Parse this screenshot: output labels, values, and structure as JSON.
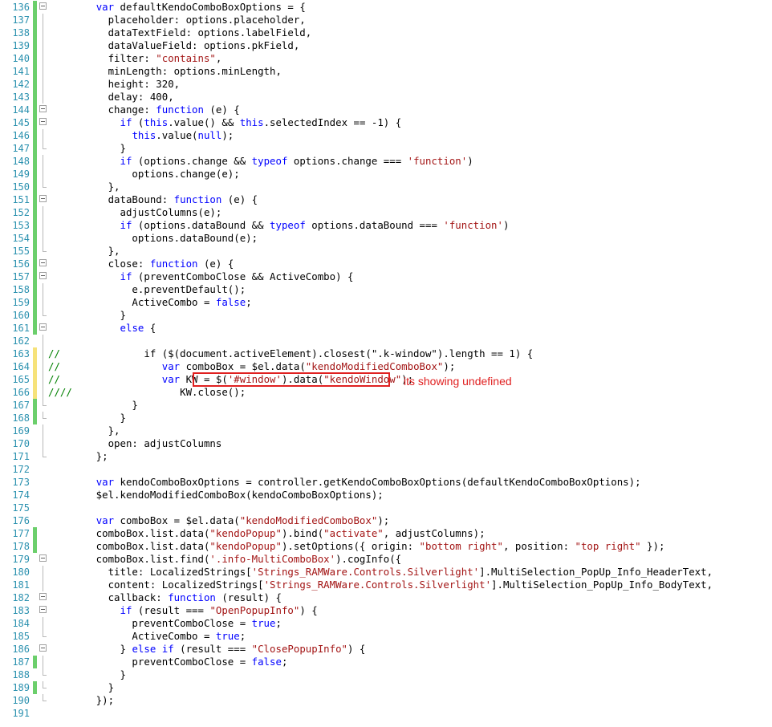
{
  "editor": {
    "lines": [
      {
        "n": "136",
        "bar": "g",
        "fold": true,
        "code": [
          [
            "        ",
            ""
          ],
          [
            "var",
            "k"
          ],
          [
            " defaultKendoComboBoxOptions = {",
            ""
          ]
        ]
      },
      {
        "n": "137",
        "bar": "g",
        "fold": false,
        "code": [
          [
            "          placeholder: options.placeholder,",
            ""
          ]
        ]
      },
      {
        "n": "138",
        "bar": "g",
        "fold": false,
        "code": [
          [
            "          dataTextField: options.labelField,",
            ""
          ]
        ]
      },
      {
        "n": "139",
        "bar": "g",
        "fold": false,
        "code": [
          [
            "          dataValueField: options.pkField,",
            ""
          ]
        ]
      },
      {
        "n": "140",
        "bar": "g",
        "fold": false,
        "code": [
          [
            "          filter: ",
            ""
          ],
          [
            "\"contains\"",
            "s"
          ],
          [
            ",",
            ""
          ]
        ]
      },
      {
        "n": "141",
        "bar": "g",
        "fold": false,
        "code": [
          [
            "          minLength: options.minLength,",
            ""
          ]
        ]
      },
      {
        "n": "142",
        "bar": "g",
        "fold": false,
        "code": [
          [
            "          height: 320,",
            ""
          ]
        ]
      },
      {
        "n": "143",
        "bar": "g",
        "fold": false,
        "code": [
          [
            "          delay: 400,",
            ""
          ]
        ]
      },
      {
        "n": "144",
        "bar": "g",
        "fold": true,
        "code": [
          [
            "          change: ",
            ""
          ],
          [
            "function",
            "k"
          ],
          [
            " (e) {",
            ""
          ]
        ]
      },
      {
        "n": "145",
        "bar": "g",
        "fold": true,
        "code": [
          [
            "            ",
            ""
          ],
          [
            "if",
            "k"
          ],
          [
            " (",
            ""
          ],
          [
            "this",
            "k"
          ],
          [
            ".value() && ",
            ""
          ],
          [
            "this",
            "k"
          ],
          [
            ".selectedIndex == -1) {",
            ""
          ]
        ]
      },
      {
        "n": "146",
        "bar": "g",
        "fold": false,
        "code": [
          [
            "              ",
            ""
          ],
          [
            "this",
            "k"
          ],
          [
            ".value(",
            ""
          ],
          [
            "null",
            "k"
          ],
          [
            ");",
            ""
          ]
        ]
      },
      {
        "n": "147",
        "bar": "g",
        "fold": false,
        "code": [
          [
            "            }",
            ""
          ]
        ]
      },
      {
        "n": "148",
        "bar": "g",
        "fold": false,
        "code": [
          [
            "            ",
            ""
          ],
          [
            "if",
            "k"
          ],
          [
            " (options.change && ",
            ""
          ],
          [
            "typeof",
            "k"
          ],
          [
            " options.change === ",
            ""
          ],
          [
            "'function'",
            "s"
          ],
          [
            ")",
            ""
          ]
        ]
      },
      {
        "n": "149",
        "bar": "g",
        "fold": false,
        "code": [
          [
            "              options.change(e);",
            ""
          ]
        ]
      },
      {
        "n": "150",
        "bar": "g",
        "fold": false,
        "code": [
          [
            "          },",
            ""
          ]
        ]
      },
      {
        "n": "151",
        "bar": "g",
        "fold": true,
        "code": [
          [
            "          dataBound: ",
            ""
          ],
          [
            "function",
            "k"
          ],
          [
            " (e) {",
            ""
          ]
        ]
      },
      {
        "n": "152",
        "bar": "g",
        "fold": false,
        "code": [
          [
            "            adjustColumns(e);",
            ""
          ]
        ]
      },
      {
        "n": "153",
        "bar": "g",
        "fold": false,
        "code": [
          [
            "            ",
            ""
          ],
          [
            "if",
            "k"
          ],
          [
            " (options.dataBound && ",
            ""
          ],
          [
            "typeof",
            "k"
          ],
          [
            " options.dataBound === ",
            ""
          ],
          [
            "'function'",
            "s"
          ],
          [
            ")",
            ""
          ]
        ]
      },
      {
        "n": "154",
        "bar": "g",
        "fold": false,
        "code": [
          [
            "              options.dataBound(e);",
            ""
          ]
        ]
      },
      {
        "n": "155",
        "bar": "g",
        "fold": false,
        "code": [
          [
            "          },",
            ""
          ]
        ]
      },
      {
        "n": "156",
        "bar": "g",
        "fold": true,
        "code": [
          [
            "          close: ",
            ""
          ],
          [
            "function",
            "k"
          ],
          [
            " (e) {",
            ""
          ]
        ]
      },
      {
        "n": "157",
        "bar": "g",
        "fold": true,
        "code": [
          [
            "            ",
            ""
          ],
          [
            "if",
            "k"
          ],
          [
            " (preventComboClose && ActiveCombo) {",
            ""
          ]
        ]
      },
      {
        "n": "158",
        "bar": "g",
        "fold": false,
        "code": [
          [
            "              e.preventDefault();",
            ""
          ]
        ]
      },
      {
        "n": "159",
        "bar": "g",
        "fold": false,
        "code": [
          [
            "              ActiveCombo = ",
            ""
          ],
          [
            "false",
            "k"
          ],
          [
            ";",
            ""
          ]
        ]
      },
      {
        "n": "160",
        "bar": "g",
        "fold": false,
        "code": [
          [
            "            }",
            ""
          ]
        ]
      },
      {
        "n": "161",
        "bar": "g",
        "fold": true,
        "code": [
          [
            "            ",
            ""
          ],
          [
            "else",
            "k"
          ],
          [
            " {",
            ""
          ]
        ]
      },
      {
        "n": "162",
        "bar": "",
        "fold": false,
        "code": [
          [
            "",
            ""
          ]
        ]
      },
      {
        "n": "163",
        "bar": "y",
        "fold": false,
        "code": [
          [
            "//",
            "c"
          ],
          [
            "              if ($(document.activeElement).closest(\".k-window\").length == 1) {",
            ""
          ]
        ]
      },
      {
        "n": "164",
        "bar": "y",
        "fold": false,
        "code": [
          [
            "//",
            "c"
          ],
          [
            "                 ",
            ""
          ],
          [
            "var",
            "k"
          ],
          [
            " comboBox = $el.data(",
            ""
          ],
          [
            "\"kendoModifiedComboBox\"",
            "s"
          ],
          [
            ");",
            ""
          ]
        ]
      },
      {
        "n": "165",
        "bar": "y",
        "fold": false,
        "code": [
          [
            "//",
            "c"
          ],
          [
            "                 ",
            ""
          ],
          [
            "var",
            "k"
          ],
          [
            " KW = $(",
            ""
          ],
          [
            "'#window'",
            "s"
          ],
          [
            ").data(",
            ""
          ],
          [
            "\"kendoWindow\"",
            "s"
          ],
          [
            ");",
            ""
          ]
        ]
      },
      {
        "n": "166",
        "bar": "y",
        "fold": false,
        "code": [
          [
            "////",
            "c"
          ],
          [
            "                  KW.close();",
            ""
          ]
        ]
      },
      {
        "n": "167",
        "bar": "g",
        "fold": false,
        "code": [
          [
            "              }",
            ""
          ]
        ]
      },
      {
        "n": "168",
        "bar": "g",
        "fold": false,
        "code": [
          [
            "            }",
            ""
          ]
        ]
      },
      {
        "n": "169",
        "bar": "",
        "fold": false,
        "code": [
          [
            "          },",
            ""
          ]
        ]
      },
      {
        "n": "170",
        "bar": "",
        "fold": false,
        "code": [
          [
            "          open: adjustColumns",
            ""
          ]
        ]
      },
      {
        "n": "171",
        "bar": "",
        "fold": false,
        "code": [
          [
            "        };",
            ""
          ]
        ]
      },
      {
        "n": "172",
        "bar": "",
        "fold": false,
        "code": [
          [
            "",
            ""
          ]
        ]
      },
      {
        "n": "173",
        "bar": "",
        "fold": false,
        "code": [
          [
            "        ",
            ""
          ],
          [
            "var",
            "k"
          ],
          [
            " kendoComboBoxOptions = controller.getKendoComboBoxOptions(defaultKendoComboBoxOptions);",
            ""
          ]
        ]
      },
      {
        "n": "174",
        "bar": "",
        "fold": false,
        "code": [
          [
            "        $el.kendoModifiedComboBox(kendoComboBoxOptions);",
            ""
          ]
        ]
      },
      {
        "n": "175",
        "bar": "",
        "fold": false,
        "code": [
          [
            "",
            ""
          ]
        ]
      },
      {
        "n": "176",
        "bar": "",
        "fold": false,
        "code": [
          [
            "        ",
            ""
          ],
          [
            "var",
            "k"
          ],
          [
            " comboBox = $el.data(",
            ""
          ],
          [
            "\"kendoModifiedComboBox\"",
            "s"
          ],
          [
            ");",
            ""
          ]
        ]
      },
      {
        "n": "177",
        "bar": "g",
        "fold": false,
        "code": [
          [
            "        comboBox.list.data(",
            ""
          ],
          [
            "\"kendoPopup\"",
            "s"
          ],
          [
            ").bind(",
            ""
          ],
          [
            "\"activate\"",
            "s"
          ],
          [
            ", adjustColumns);",
            ""
          ]
        ]
      },
      {
        "n": "178",
        "bar": "g",
        "fold": false,
        "code": [
          [
            "        comboBox.list.data(",
            ""
          ],
          [
            "\"kendoPopup\"",
            "s"
          ],
          [
            ").setOptions({ origin: ",
            ""
          ],
          [
            "\"bottom right\"",
            "s"
          ],
          [
            ", position: ",
            ""
          ],
          [
            "\"top right\"",
            "s"
          ],
          [
            " });",
            ""
          ]
        ]
      },
      {
        "n": "179",
        "bar": "",
        "fold": true,
        "code": [
          [
            "        comboBox.list.find(",
            ""
          ],
          [
            "'.info-MultiComboBox'",
            "s"
          ],
          [
            ").cogInfo({",
            ""
          ]
        ]
      },
      {
        "n": "180",
        "bar": "",
        "fold": false,
        "code": [
          [
            "          title: LocalizedStrings[",
            ""
          ],
          [
            "'Strings_RAMWare.Controls.Silverlight'",
            "s"
          ],
          [
            "].MultiSelection_PopUp_Info_HeaderText,",
            ""
          ]
        ]
      },
      {
        "n": "181",
        "bar": "",
        "fold": false,
        "code": [
          [
            "          content: LocalizedStrings[",
            ""
          ],
          [
            "'Strings_RAMWare.Controls.Silverlight'",
            "s"
          ],
          [
            "].MultiSelection_PopUp_Info_BodyText,",
            ""
          ]
        ]
      },
      {
        "n": "182",
        "bar": "",
        "fold": true,
        "code": [
          [
            "          callback: ",
            ""
          ],
          [
            "function",
            "k"
          ],
          [
            " (result) {",
            ""
          ]
        ]
      },
      {
        "n": "183",
        "bar": "",
        "fold": true,
        "code": [
          [
            "            ",
            ""
          ],
          [
            "if",
            "k"
          ],
          [
            " (result === ",
            ""
          ],
          [
            "\"OpenPopupInfo\"",
            "s"
          ],
          [
            ") {",
            ""
          ]
        ]
      },
      {
        "n": "184",
        "bar": "",
        "fold": false,
        "code": [
          [
            "              preventComboClose = ",
            ""
          ],
          [
            "true",
            "k"
          ],
          [
            ";",
            ""
          ]
        ]
      },
      {
        "n": "185",
        "bar": "",
        "fold": false,
        "code": [
          [
            "              ActiveCombo = ",
            ""
          ],
          [
            "true",
            "k"
          ],
          [
            ";",
            ""
          ]
        ]
      },
      {
        "n": "186",
        "bar": "",
        "fold": true,
        "code": [
          [
            "            } ",
            ""
          ],
          [
            "else if",
            "k"
          ],
          [
            " (result === ",
            ""
          ],
          [
            "\"ClosePopupInfo\"",
            "s"
          ],
          [
            ") {",
            ""
          ]
        ]
      },
      {
        "n": "187",
        "bar": "g",
        "fold": false,
        "code": [
          [
            "              preventComboClose = ",
            ""
          ],
          [
            "false",
            "k"
          ],
          [
            ";",
            ""
          ]
        ]
      },
      {
        "n": "188",
        "bar": "",
        "fold": false,
        "code": [
          [
            "            }",
            ""
          ]
        ]
      },
      {
        "n": "189",
        "bar": "g",
        "fold": false,
        "code": [
          [
            "          }",
            ""
          ]
        ]
      },
      {
        "n": "190",
        "bar": "",
        "fold": false,
        "code": [
          [
            "        });",
            ""
          ]
        ]
      },
      {
        "n": "191",
        "bar": "",
        "fold": false,
        "code": [
          [
            "",
            ""
          ]
        ]
      }
    ]
  },
  "annotation": {
    "text": "its showing undefined",
    "color": "#e02020"
  },
  "colors": {
    "keyword": "#0000ff",
    "string": "#a31515",
    "comment": "#008000",
    "line_number": "#2b91af",
    "changed_saved": "#6ccf6c",
    "changed_unsaved": "#f6e27a"
  }
}
